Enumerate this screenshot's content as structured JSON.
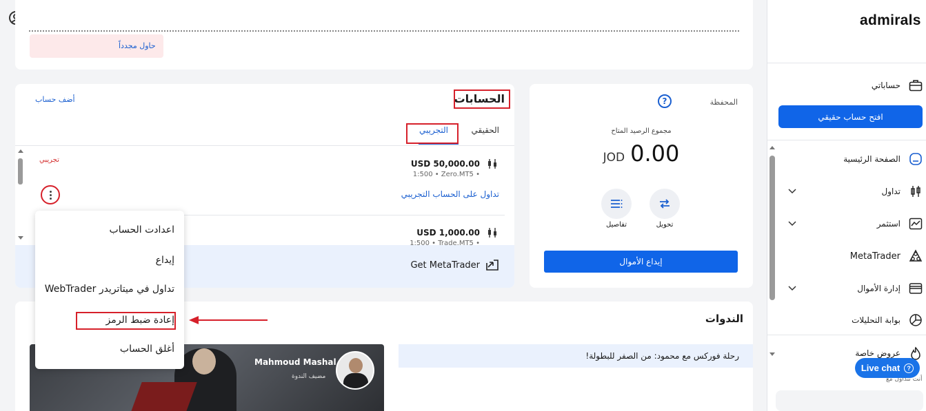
{
  "sidebar": {
    "logo": "admirals",
    "my_accounts": "حساباتي",
    "open_account_button": "افتح حساب حقيقي",
    "items": [
      {
        "label": "الصفحة الرئيسية",
        "icon": "home-icon",
        "active": true
      },
      {
        "label": "تداول",
        "icon": "candlestick-icon"
      },
      {
        "label": "استثمر",
        "icon": "chart-icon"
      },
      {
        "label": "MetaTrader",
        "icon": "metatrader-icon"
      },
      {
        "label": "إدارة الأموال",
        "icon": "wallet-icon"
      },
      {
        "label": "بوابة التحليلات",
        "icon": "analytics-icon"
      }
    ],
    "offers_label": "عروض خاصة",
    "offers_sub": "أنت تتداول مع"
  },
  "alert": {
    "retry_link": "حاول مجدداً"
  },
  "wallet": {
    "title": "المحفظة",
    "balance_label": "مجموع الرصيد المتاح",
    "balance_value": "0.00",
    "currency": "JOD",
    "transfer_label": "تحويل",
    "details_label": "تفاصيل",
    "deposit_button": "إيداع الأموال"
  },
  "accounts": {
    "title": "الحسابات",
    "add_account": "أضف حساب",
    "tab_real": "الحقيقي",
    "tab_demo": "التجريبي",
    "demo_badge": "تجريبي",
    "list": [
      {
        "balance": "USD 50,000.00",
        "meta": "1:500 • Zero.MT5 •",
        "trade_link": "تداول على الحساب التجريبي"
      },
      {
        "balance": "USD 1,000.00",
        "meta": "1:500 • Trade.MT5 •"
      }
    ],
    "get_metatrader": "Get MetaTrader"
  },
  "context_menu": {
    "items": [
      "اعدادت الحساب",
      "إيداع",
      "تداول في ميتاتريدر WebTrader",
      "إعادة ضبط الرمز",
      "أغلق الحساب"
    ]
  },
  "webinars": {
    "title": "الندوات",
    "webinar_title": "رحلة فوركس مع محمود: من الصفر للبطولة!",
    "host_name": "Mahmoud Mashal",
    "host_role": "مضيف الندوة"
  },
  "live_chat": "Live chat",
  "colors": {
    "accent": "#1065e8",
    "annotation_red": "#d6202a",
    "demo_red": "#d32f2f"
  }
}
